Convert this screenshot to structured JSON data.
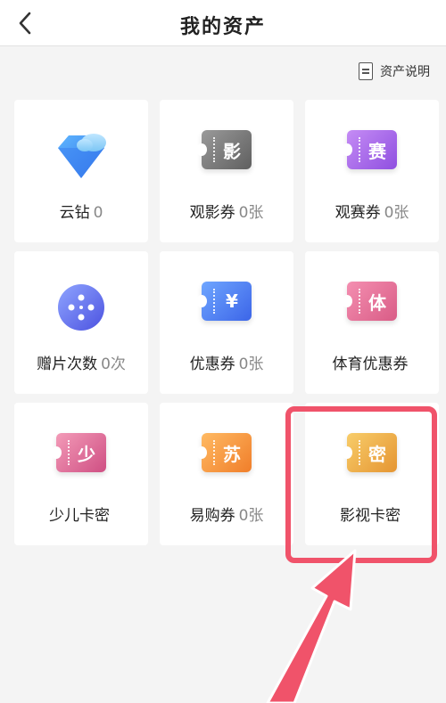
{
  "header": {
    "title": "我的资产",
    "back_icon": "chevron-left-icon"
  },
  "explain": {
    "label": "资产说明",
    "icon": "document-icon"
  },
  "items": [
    {
      "name": "云钻",
      "count": "0",
      "icon": "diamond-cloud-icon"
    },
    {
      "name": "观影券",
      "count": "0张",
      "icon": "ticket-movie-icon",
      "glyph": "影"
    },
    {
      "name": "观赛券",
      "count": "0张",
      "icon": "ticket-match-icon",
      "glyph": "赛"
    },
    {
      "name": "赠片次数",
      "count": "0次",
      "icon": "film-reel-icon"
    },
    {
      "name": "优惠券",
      "count": "0张",
      "icon": "ticket-coupon-icon",
      "glyph": "¥"
    },
    {
      "name": "体育优惠券",
      "count": "",
      "icon": "ticket-sports-icon",
      "glyph": "体"
    },
    {
      "name": "少儿卡密",
      "count": "",
      "icon": "ticket-kids-icon",
      "glyph": "少"
    },
    {
      "name": "易购券",
      "count": "0张",
      "icon": "ticket-suning-icon",
      "glyph": "苏"
    },
    {
      "name": "影视卡密",
      "count": "",
      "icon": "ticket-video-code-icon",
      "glyph": "密"
    }
  ],
  "colors": {
    "highlight": "#f0536a",
    "count": "#888888"
  }
}
